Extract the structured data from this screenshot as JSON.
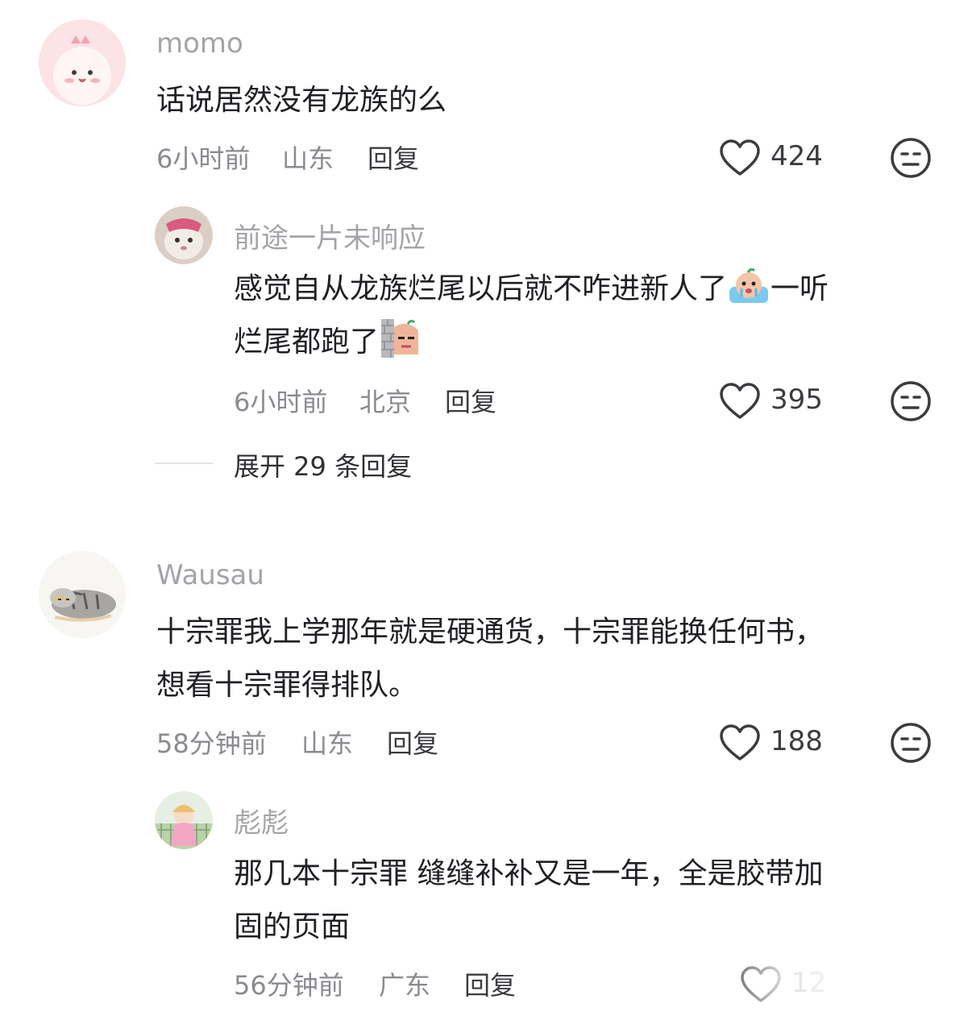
{
  "comments": [
    {
      "username": "momo",
      "text": "话说居然没有龙族的么",
      "time": "6小时前",
      "location": "山东",
      "reply_label": "回复",
      "likes": "424",
      "replies": [
        {
          "username": "前途一片未响应",
          "text_part1": "感觉自从龙族烂尾以后就不咋进新人了",
          "text_part2": "一听",
          "text_part3": "烂尾都跑了",
          "time": "6小时前",
          "location": "北京",
          "reply_label": "回复",
          "likes": "395"
        }
      ],
      "expand_label": "展开 29 条回复"
    },
    {
      "username": "Wausau",
      "text_line1": "十宗罪我上学那年就是硬通货，十宗罪能换任何书，",
      "text_line2": "想看十宗罪得排队。",
      "time": "58分钟前",
      "location": "山东",
      "reply_label": "回复",
      "likes": "188",
      "replies": [
        {
          "username": "彪彪",
          "text_line1": "那几本十宗罪 缝缝补补又是一年，全是胶带加",
          "text_line2": "固的页面",
          "time": "56分钟前",
          "location": "广东",
          "reply_label": "回复",
          "likes": "12"
        }
      ]
    }
  ],
  "icons": {
    "like": "heart-outline-icon",
    "dislike": "meh-face-icon",
    "emoji_cry": "crying-sticker-emoji",
    "emoji_peek": "peeking-sticker-emoji"
  },
  "colors": {
    "username": "#a3a4a8",
    "meta": "#8a8b90",
    "text": "#1f2024"
  }
}
